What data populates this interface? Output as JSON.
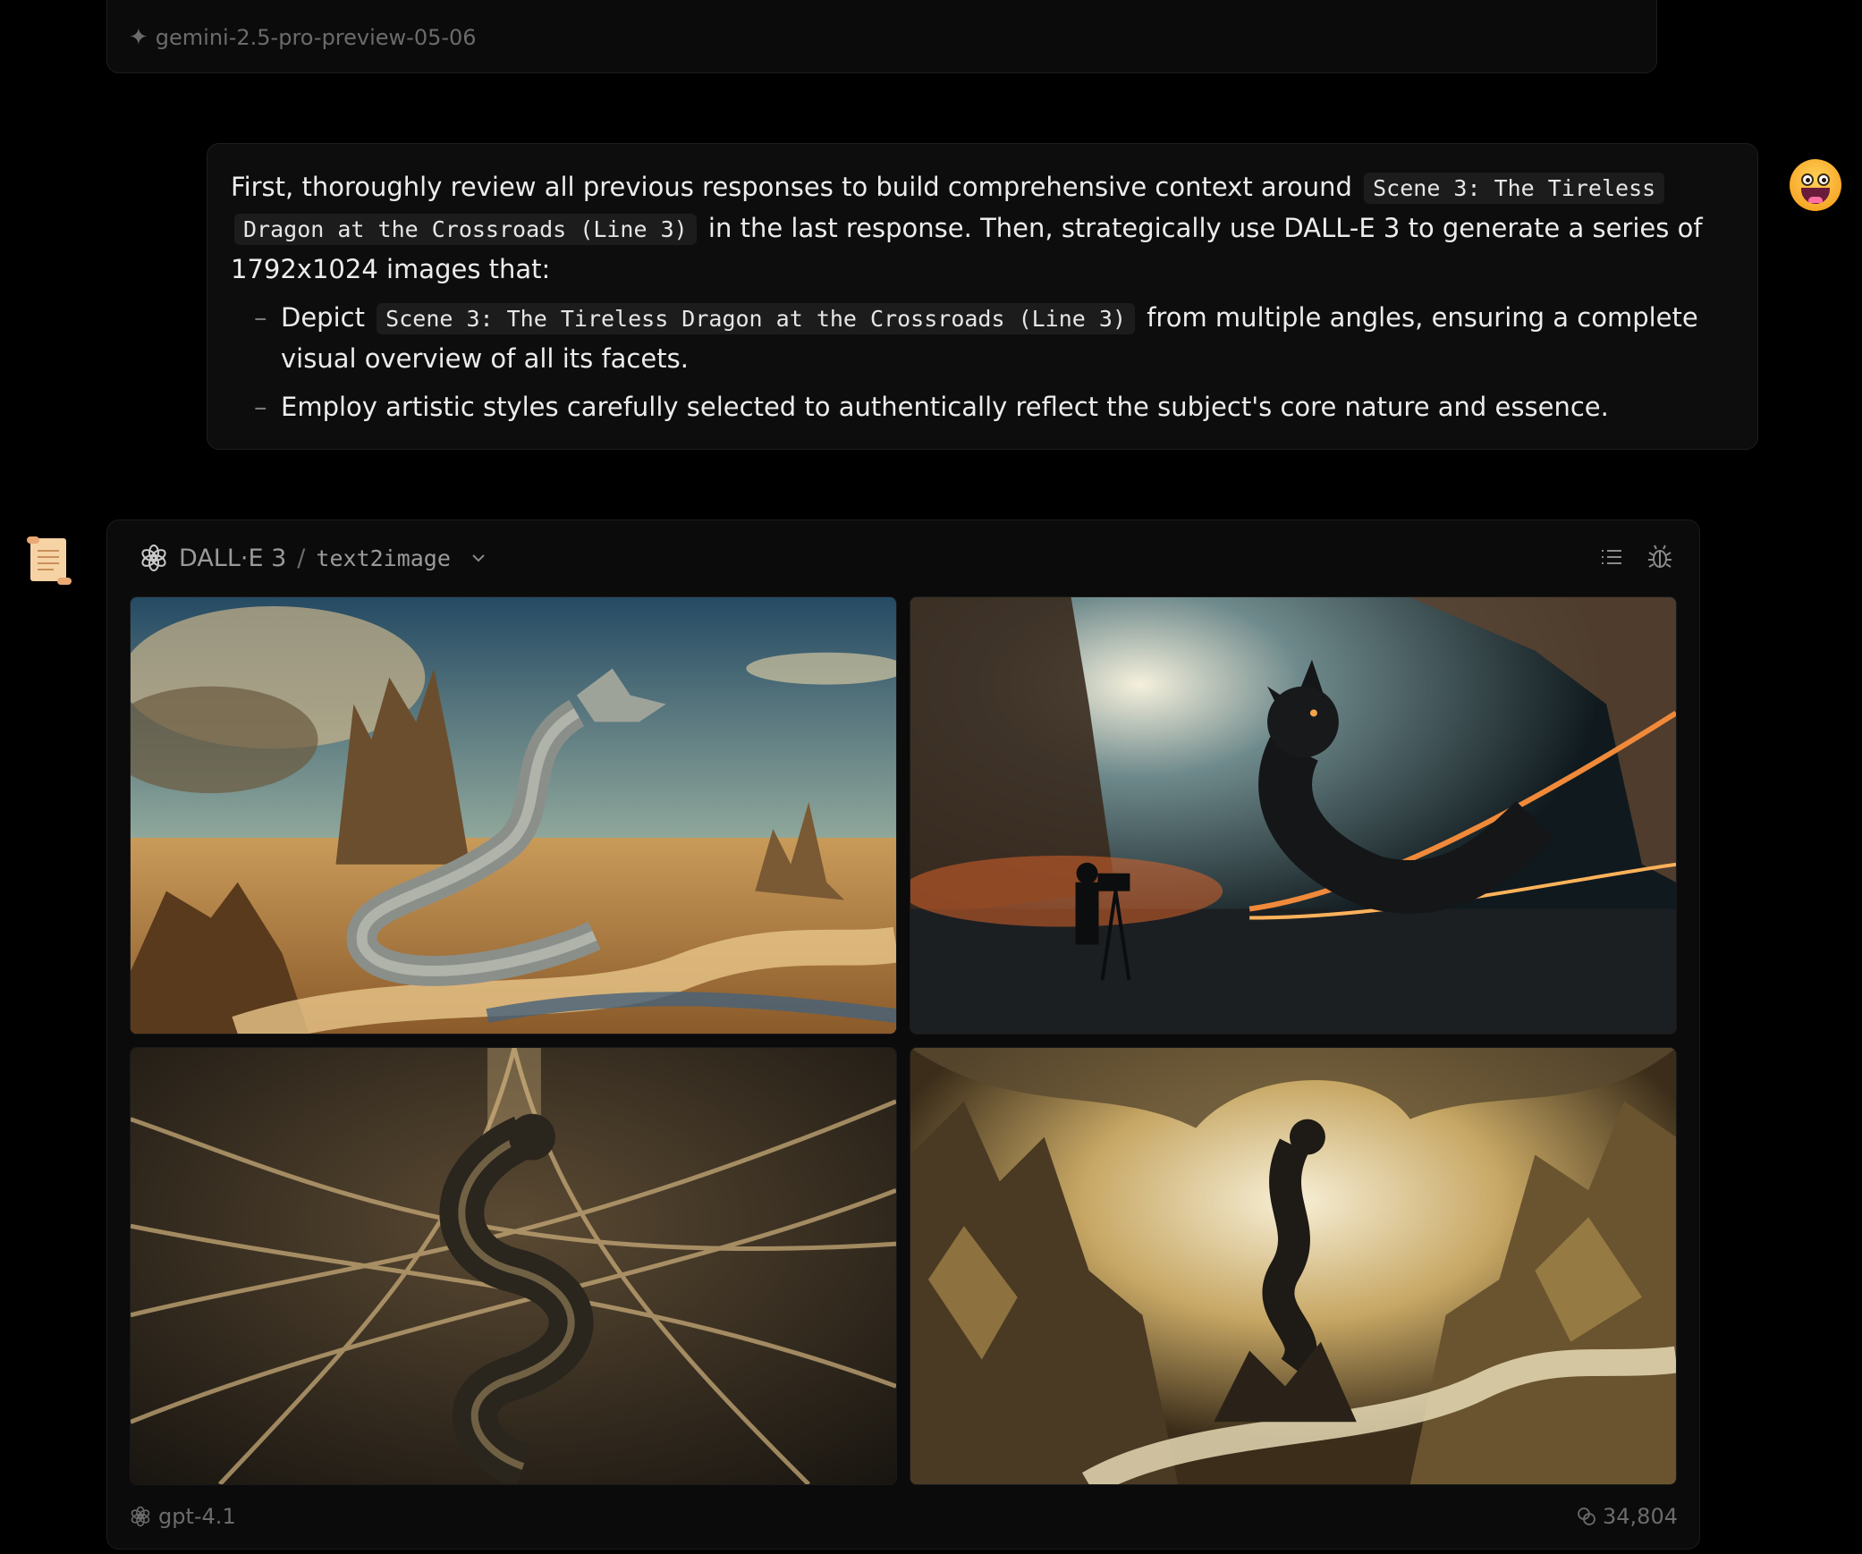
{
  "previous_message": {
    "model_tag": "gemini-2.5-pro-preview-05-06",
    "spark_glyph": "✦"
  },
  "user_message": {
    "seg1": "First, thoroughly review all previous responses to build comprehensive context around",
    "code1": "Scene 3: The Tireless Dragon at the Crossroads (Line 3)",
    "seg2": "in the last response. Then, strategically use DALL-E 3 to generate a series of 1792x1024 images that:",
    "bullets": [
      {
        "pre": "Depict",
        "code": "Scene 3: The Tireless Dragon at the Crossroads (Line 3)",
        "post": "from multiple angles, ensuring a complete visual overview of all its facets."
      },
      {
        "text": "Employ artistic styles carefully selected to authentically reflect the subject's core nature and essence."
      }
    ],
    "bullet_marker": "–"
  },
  "assistant": {
    "model_name": "DALL·E 3",
    "separator": "/",
    "tool_name": "text2image",
    "icons": {
      "provider": "openai-icon",
      "dropdown": "chevron-down-icon",
      "list": "list-icon",
      "debug": "bug-icon",
      "avatar_user": "grinning-face-icon",
      "avatar_assistant": "scroll-icon"
    },
    "images": [
      {
        "name": "desert-dragon-image"
      },
      {
        "name": "cinematic-dragon-image"
      },
      {
        "name": "aerial-dragon-image"
      },
      {
        "name": "painted-dragon-image"
      }
    ],
    "footer_model": "gpt-4.1",
    "footer_tokens": "34,804"
  },
  "colors": {
    "background": "#000000",
    "card": "#0b0b0b",
    "text": "#ececec",
    "muted": "#6b6b6b",
    "code_bg": "#1c1c1c"
  }
}
